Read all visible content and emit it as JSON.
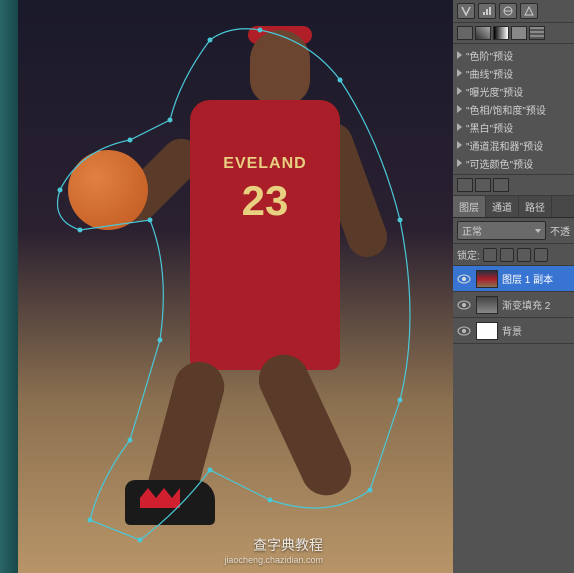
{
  "canvas": {
    "jersey_team": "EVELAND",
    "jersey_number": "23"
  },
  "presets": [
    "\"色阶\"预设",
    "\"曲线\"预设",
    "\"曝光度\"预设",
    "\"色相/饱和度\"预设",
    "\"黑白\"预设",
    "\"通道混和器\"预设",
    "\"可选颜色\"预设"
  ],
  "tabs": {
    "layers": "图层",
    "channels": "通道",
    "paths": "路径"
  },
  "blend": {
    "mode": "正常",
    "opacity_label": "不透"
  },
  "lock": {
    "label": "锁定:"
  },
  "layers": [
    {
      "name": "图层 1 副本",
      "selected": true,
      "thumb": "player"
    },
    {
      "name": "渐变填充 2",
      "selected": false,
      "thumb": "gradient"
    },
    {
      "name": "背景",
      "selected": false,
      "thumb": "white"
    }
  ],
  "watermark": {
    "main": "查字典教程",
    "sub": "jiaocheng.chazidian.com"
  }
}
